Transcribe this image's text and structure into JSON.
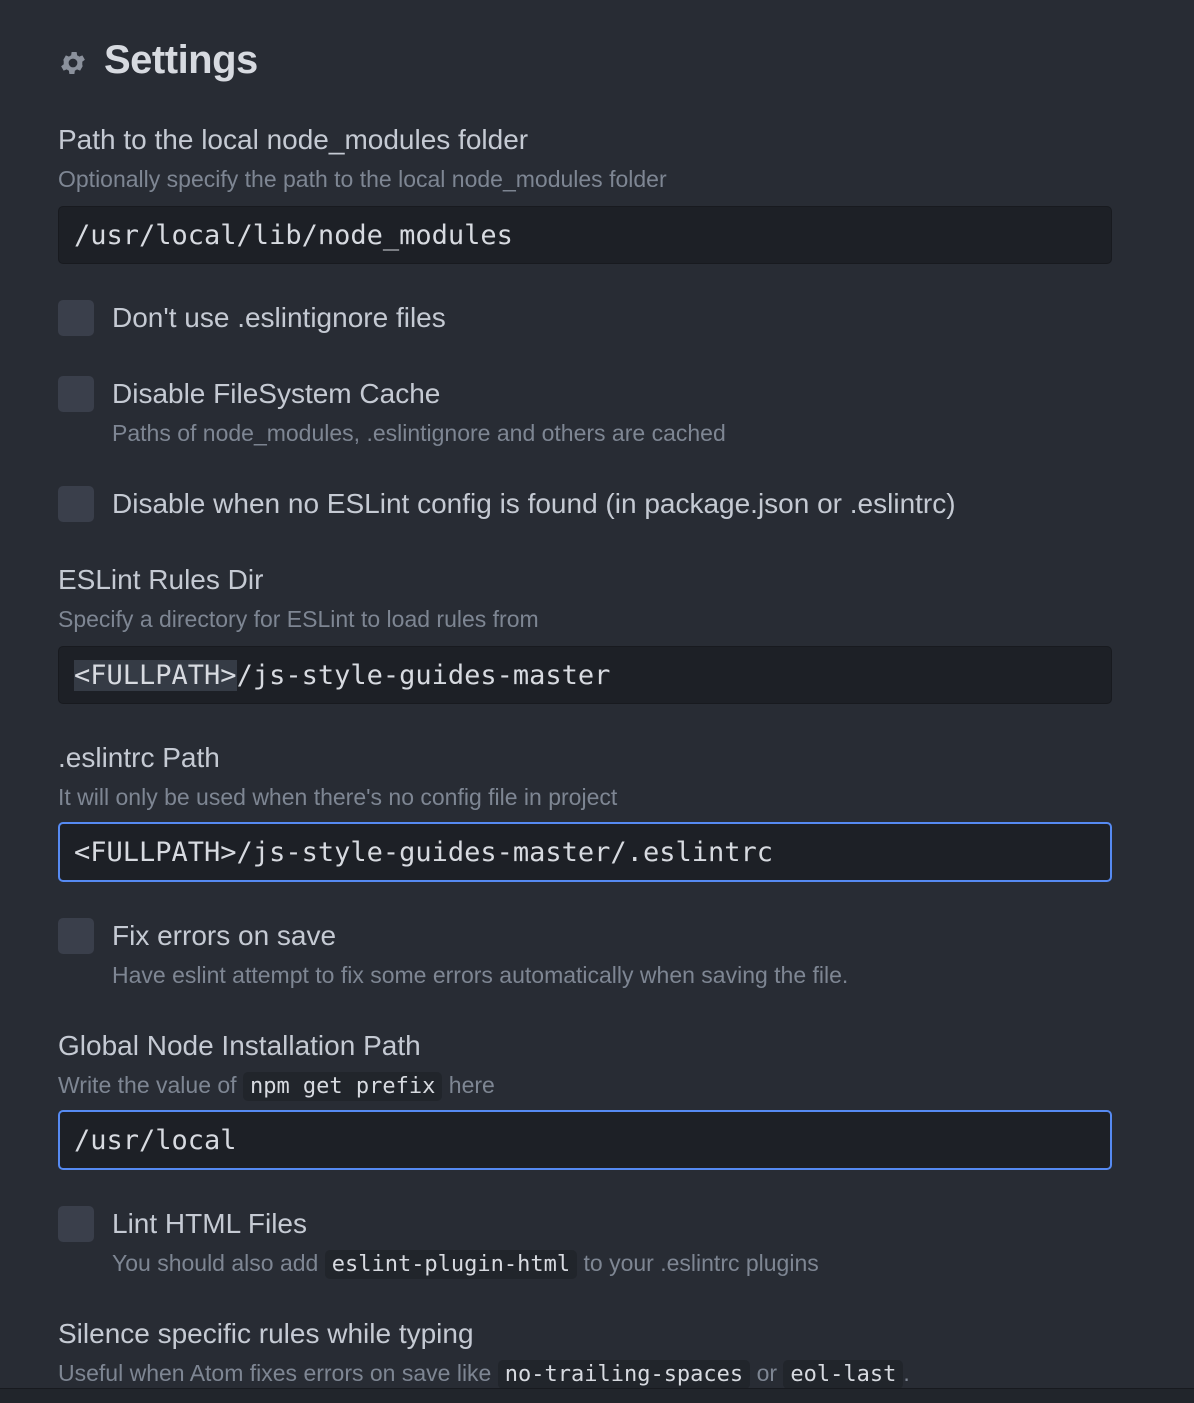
{
  "header": {
    "title": "Settings",
    "icon": "gear-icon"
  },
  "settings": {
    "node_modules_path": {
      "label": "Path to the local node_modules folder",
      "description": "Optionally specify the path to the local node_modules folder",
      "value": "/usr/local/lib/node_modules"
    },
    "no_eslintignore": {
      "label": "Don't use .eslintignore files",
      "checked": false
    },
    "disable_fs_cache": {
      "label": "Disable FileSystem Cache",
      "description": "Paths of node_modules, .eslintignore and others are cached",
      "checked": false
    },
    "disable_no_config": {
      "label": "Disable when no ESLint config is found (in package.json or .eslintrc)",
      "checked": false
    },
    "rules_dir": {
      "label": "ESLint Rules Dir",
      "description": "Specify a directory for ESLint to load rules from",
      "value_selected": "<FULLPATH>",
      "value_rest": "/js-style-guides-master"
    },
    "eslintrc_path": {
      "label": ".eslintrc Path",
      "description": "It will only be used when there's no config file in project",
      "value": "<FULLPATH>/js-style-guides-master/.eslintrc"
    },
    "fix_on_save": {
      "label": "Fix errors on save",
      "description": "Have eslint attempt to fix some errors automatically when saving the file.",
      "checked": false
    },
    "global_node_path": {
      "label": "Global Node Installation Path",
      "description_pre": "Write the value of",
      "description_code": "npm get prefix",
      "description_post": "here",
      "value": "/usr/local"
    },
    "lint_html": {
      "label": "Lint HTML Files",
      "description_pre": "You should also add",
      "description_code": "eslint-plugin-html",
      "description_post": "to your .eslintrc plugins",
      "checked": false
    },
    "silence_rules": {
      "label": "Silence specific rules while typing",
      "description_pre": "Useful when Atom fixes errors on save like",
      "description_code1": "no-trailing-spaces",
      "description_mid": "or",
      "description_code2": "eol-last",
      "description_post": "."
    }
  },
  "colors": {
    "background": "#282c34",
    "text": "#c5cad3",
    "muted": "#7e8693",
    "focus_border": "#568af2"
  }
}
